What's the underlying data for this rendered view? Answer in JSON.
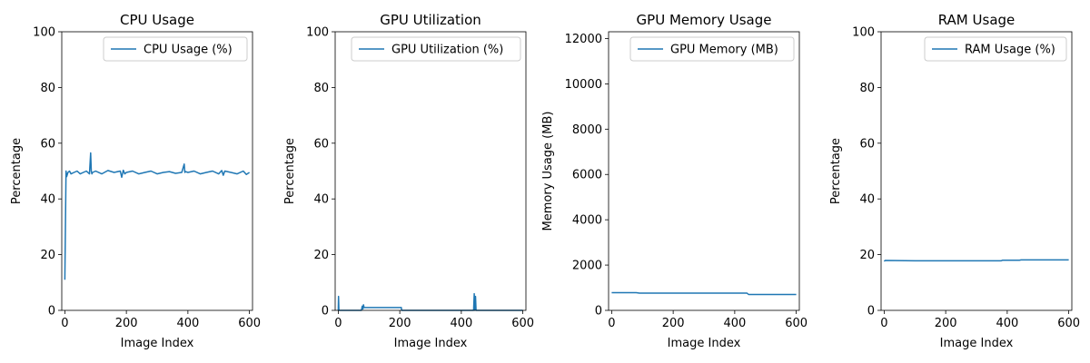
{
  "chart_data": [
    {
      "type": "line",
      "title": "CPU Usage",
      "xlabel": "Image Index",
      "ylabel": "Percentage",
      "xlim": [
        -10,
        610
      ],
      "ylim": [
        0,
        100
      ],
      "xticks": [
        0,
        200,
        400,
        600
      ],
      "yticks": [
        0,
        20,
        40,
        60,
        80,
        100
      ],
      "legend_position": "top-right",
      "grid": false,
      "series": [
        {
          "name": "CPU Usage (%)",
          "color": "#1f77b4",
          "x": [
            0,
            2,
            4,
            6,
            10,
            15,
            20,
            30,
            40,
            50,
            60,
            70,
            80,
            84,
            86,
            88,
            90,
            100,
            120,
            140,
            160,
            180,
            185,
            190,
            195,
            200,
            220,
            240,
            260,
            280,
            300,
            320,
            340,
            360,
            380,
            388,
            390,
            392,
            400,
            420,
            440,
            460,
            480,
            500,
            510,
            515,
            520,
            540,
            560,
            580,
            590,
            600
          ],
          "y": [
            11,
            32,
            50,
            48,
            49.5,
            50,
            49,
            49.5,
            50,
            49,
            49.5,
            50,
            49,
            56.5,
            50,
            49,
            49.5,
            50,
            49,
            50.2,
            49.5,
            50,
            47.8,
            50.3,
            49,
            49.5,
            50,
            49,
            49.5,
            50,
            49,
            49.5,
            49.8,
            49.2,
            49.5,
            52.5,
            49.5,
            49.8,
            49.5,
            50,
            49,
            49.5,
            50,
            49,
            50.2,
            48.5,
            50,
            49.5,
            49,
            50,
            48.8,
            49.5
          ]
        }
      ]
    },
    {
      "type": "line",
      "title": "GPU Utilization",
      "xlabel": "Image Index",
      "ylabel": "Percentage",
      "xlim": [
        -10,
        610
      ],
      "ylim": [
        0,
        100
      ],
      "xticks": [
        0,
        200,
        400,
        600
      ],
      "yticks": [
        0,
        20,
        40,
        60,
        80,
        100
      ],
      "legend_position": "top-right",
      "grid": false,
      "series": [
        {
          "name": "GPU Utilization (%)",
          "color": "#1f77b4",
          "x": [
            0,
            1,
            2,
            3,
            10,
            50,
            75,
            78,
            80,
            82,
            84,
            86,
            90,
            120,
            150,
            180,
            200,
            205,
            206,
            300,
            440,
            442,
            444,
            446,
            448,
            500,
            600
          ],
          "y": [
            0,
            5,
            0,
            0,
            0,
            0,
            0,
            1.5,
            0.5,
            2,
            1,
            1,
            1,
            1,
            1,
            1,
            1,
            1,
            0,
            0,
            0,
            6,
            0,
            5,
            0,
            0,
            0
          ]
        }
      ]
    },
    {
      "type": "line",
      "title": "GPU Memory Usage",
      "xlabel": "Image Index",
      "ylabel": "Memory Usage (MB)",
      "xlim": [
        -10,
        610
      ],
      "ylim": [
        0,
        12300
      ],
      "xticks": [
        0,
        200,
        400,
        600
      ],
      "yticks": [
        0,
        2000,
        4000,
        6000,
        8000,
        10000,
        12000
      ],
      "legend_position": "top-right",
      "grid": false,
      "series": [
        {
          "name": "GPU Memory (MB)",
          "color": "#1f77b4",
          "x": [
            0,
            80,
            90,
            200,
            300,
            440,
            445,
            500,
            600
          ],
          "y": [
            780,
            780,
            760,
            760,
            760,
            760,
            700,
            700,
            700
          ]
        }
      ]
    },
    {
      "type": "line",
      "title": "RAM Usage",
      "xlabel": "Image Index",
      "ylabel": "Percentage",
      "xlim": [
        -10,
        610
      ],
      "ylim": [
        0,
        100
      ],
      "xticks": [
        0,
        200,
        400,
        600
      ],
      "yticks": [
        0,
        20,
        40,
        60,
        80,
        100
      ],
      "legend_position": "top-right",
      "grid": false,
      "series": [
        {
          "name": "RAM Usage (%)",
          "color": "#1f77b4",
          "x": [
            0,
            3,
            100,
            200,
            300,
            380,
            385,
            440,
            445,
            500,
            600
          ],
          "y": [
            17.6,
            17.9,
            17.8,
            17.8,
            17.8,
            17.8,
            18,
            18,
            18.1,
            18.1,
            18.1
          ]
        }
      ]
    }
  ]
}
